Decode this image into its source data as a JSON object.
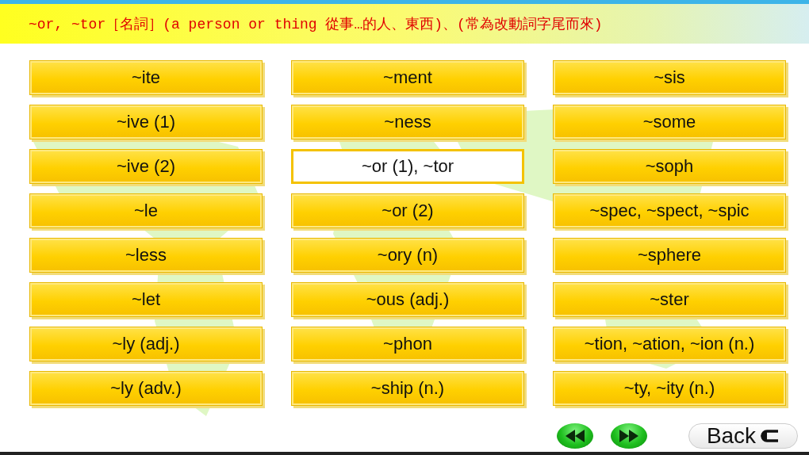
{
  "header": {
    "title": "~or, ~tor［名詞］(a person or thing 從事…的人、東西)、(常為改動詞字尾而來)"
  },
  "suffixes": [
    {
      "label": "~ite",
      "selected": false
    },
    {
      "label": "~ive (1)",
      "selected": false
    },
    {
      "label": "~ive (2)",
      "selected": false
    },
    {
      "label": "~le",
      "selected": false
    },
    {
      "label": "~less",
      "selected": false
    },
    {
      "label": "~let",
      "selected": false
    },
    {
      "label": "~ly (adj.)",
      "selected": false
    },
    {
      "label": "~ly (adv.)",
      "selected": false
    },
    {
      "label": "~ment",
      "selected": false
    },
    {
      "label": "~ness",
      "selected": false
    },
    {
      "label": "~or (1), ~tor",
      "selected": true
    },
    {
      "label": "~or (2)",
      "selected": false
    },
    {
      "label": "~ory (n)",
      "selected": false
    },
    {
      "label": "~ous (adj.)",
      "selected": false
    },
    {
      "label": "~phon",
      "selected": false
    },
    {
      "label": "~ship (n.)",
      "selected": false
    },
    {
      "label": "~sis",
      "selected": false
    },
    {
      "label": "~some",
      "selected": false
    },
    {
      "label": "~soph",
      "selected": false
    },
    {
      "label": "~spec, ~spect, ~spic",
      "selected": false
    },
    {
      "label": "~sphere",
      "selected": false
    },
    {
      "label": "~ster",
      "selected": false
    },
    {
      "label": "~tion, ~ation, ~ion (n.)",
      "selected": false
    },
    {
      "label": "~ty, ~ity (n.)",
      "selected": false
    }
  ],
  "nav": {
    "back_label": "Back"
  }
}
